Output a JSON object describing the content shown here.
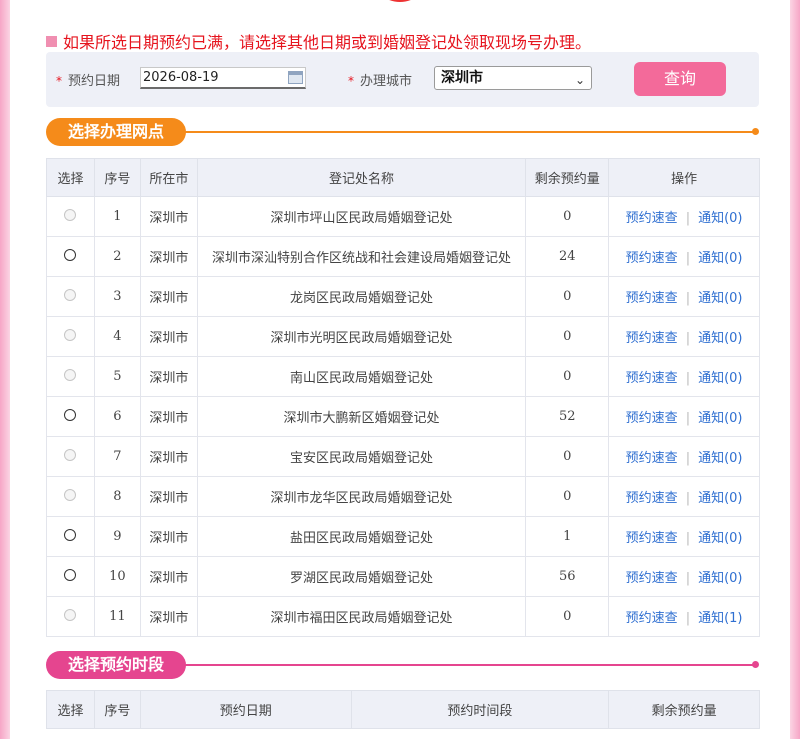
{
  "notice": "如果所选日期预约已满，请选择其他日期或到婚姻登记处领取现场号办理。",
  "query": {
    "date_label": "预约日期",
    "date_value": "2026-08-19",
    "city_label": "办理城市",
    "city_value": "深圳市",
    "button_label": "查询"
  },
  "section_branch": {
    "title": "选择办理网点"
  },
  "section_slot": {
    "title": "选择预约时段"
  },
  "branch_table": {
    "headers": [
      "选择",
      "序号",
      "所在市",
      "登记处名称",
      "剩余预约量",
      "操作"
    ],
    "action_quick": "预约速查",
    "action_notice_prefix": "通知",
    "rows": [
      {
        "no": "1",
        "city": "深圳市",
        "name": "深圳市坪山区民政局婚姻登记处",
        "remaining": "0",
        "notice": "通知(0)",
        "enabled": false
      },
      {
        "no": "2",
        "city": "深圳市",
        "name": "深圳市深汕特别合作区统战和社会建设局婚姻登记处",
        "remaining": "24",
        "notice": "通知(0)",
        "enabled": true
      },
      {
        "no": "3",
        "city": "深圳市",
        "name": "龙岗区民政局婚姻登记处",
        "remaining": "0",
        "notice": "通知(0)",
        "enabled": false
      },
      {
        "no": "4",
        "city": "深圳市",
        "name": "深圳市光明区民政局婚姻登记处",
        "remaining": "0",
        "notice": "通知(0)",
        "enabled": false
      },
      {
        "no": "5",
        "city": "深圳市",
        "name": "南山区民政局婚姻登记处",
        "remaining": "0",
        "notice": "通知(0)",
        "enabled": false
      },
      {
        "no": "6",
        "city": "深圳市",
        "name": "深圳市大鹏新区婚姻登记处",
        "remaining": "52",
        "notice": "通知(0)",
        "enabled": true
      },
      {
        "no": "7",
        "city": "深圳市",
        "name": "宝安区民政局婚姻登记处",
        "remaining": "0",
        "notice": "通知(0)",
        "enabled": false
      },
      {
        "no": "8",
        "city": "深圳市",
        "name": "深圳市龙华区民政局婚姻登记处",
        "remaining": "0",
        "notice": "通知(0)",
        "enabled": false
      },
      {
        "no": "9",
        "city": "深圳市",
        "name": "盐田区民政局婚姻登记处",
        "remaining": "1",
        "notice": "通知(0)",
        "enabled": true
      },
      {
        "no": "10",
        "city": "深圳市",
        "name": "罗湖区民政局婚姻登记处",
        "remaining": "56",
        "notice": "通知(0)",
        "enabled": true
      },
      {
        "no": "11",
        "city": "深圳市",
        "name": "深圳市福田区民政局婚姻登记处",
        "remaining": "0",
        "notice": "通知(1)",
        "enabled": false
      }
    ]
  },
  "slot_table": {
    "headers": [
      "选择",
      "序号",
      "预约日期",
      "预约时间段",
      "剩余预约量"
    ]
  }
}
